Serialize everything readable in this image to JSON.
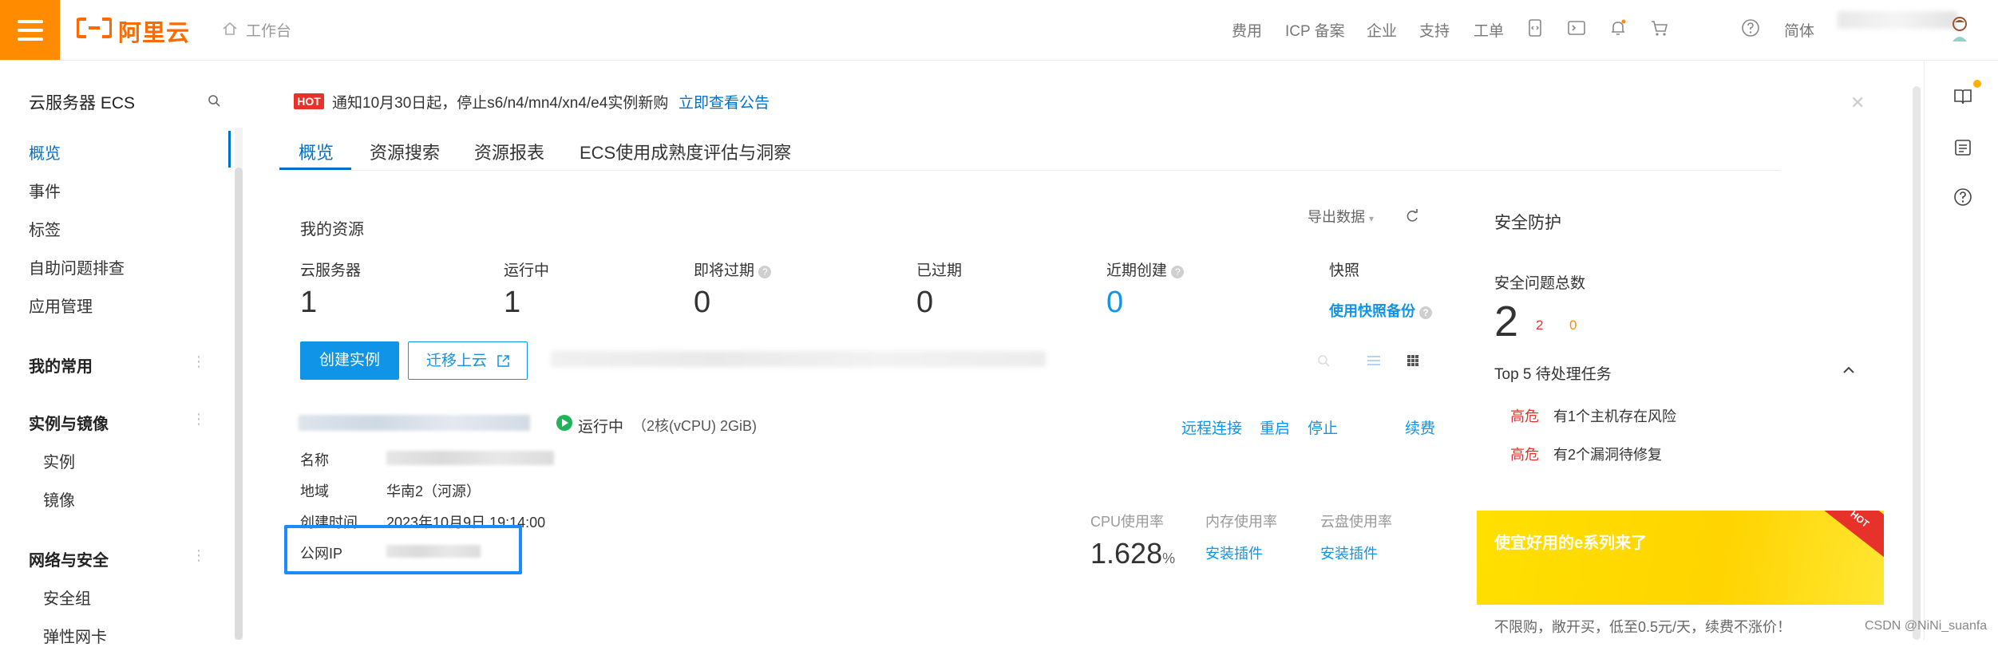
{
  "brand": {
    "name": "阿里云",
    "accent": "#ff6a00"
  },
  "breadcrumb": "工作台",
  "topnav": [
    "费用",
    "ICP 备案",
    "企业",
    "支持",
    "工单"
  ],
  "topnav_lang": "简体",
  "sidebar": {
    "title": "云服务器 ECS",
    "items": [
      "概览",
      "事件",
      "标签",
      "自助问题排查",
      "应用管理"
    ],
    "groups": [
      {
        "label": "我的常用",
        "subs": []
      },
      {
        "label": "实例与镜像",
        "subs": [
          "实例",
          "镜像"
        ]
      },
      {
        "label": "网络与安全",
        "subs": [
          "安全组",
          "弹性网卡"
        ]
      }
    ]
  },
  "notice": {
    "tag": "HOT",
    "text": "通知10月30日起，停止s6/n4/mn4/xn4/e4实例新购",
    "link": "立即查看公告"
  },
  "tabs": [
    "概览",
    "资源搜索",
    "资源报表",
    "ECS使用成熟度评估与洞察"
  ],
  "resources": {
    "title": "我的资源",
    "export": "导出数据",
    "stats": [
      {
        "label": "云服务器",
        "value": "1"
      },
      {
        "label": "运行中",
        "value": "1"
      },
      {
        "label": "即将过期",
        "value": "0"
      },
      {
        "label": "已过期",
        "value": "0"
      },
      {
        "label": "近期创建",
        "value": "0"
      },
      {
        "label": "快照",
        "value": "使用快照备份"
      }
    ],
    "create_btn": "创建实例",
    "migrate_btn": "迁移上云"
  },
  "instance": {
    "status": "运行中",
    "spec": "（2核(vCPU) 2GiB)",
    "actions": [
      "远程连接",
      "重启",
      "停止",
      "续费"
    ],
    "fields": [
      {
        "label": "名称",
        "value": ""
      },
      {
        "label": "地域",
        "value": "华南2（河源）"
      },
      {
        "label": "创建时间",
        "value": "2023年10月9日 19:14:00"
      },
      {
        "label": "公网IP",
        "value": ""
      }
    ],
    "metrics": {
      "cpu_label": "CPU使用率",
      "cpu_value": "1.628",
      "cpu_unit": "%",
      "mem_label": "内存使用率",
      "mem_action": "安装插件",
      "disk_label": "云盘使用率",
      "disk_action": "安装插件"
    }
  },
  "security": {
    "title": "安全防护",
    "total_label": "安全问题总数",
    "total": "2",
    "red": "2",
    "orange": "0",
    "top5_label": "Top 5 待处理任务",
    "tasks": [
      {
        "level": "高危",
        "text": "有1个主机存在风险"
      },
      {
        "level": "高危",
        "text": "有2个漏洞待修复"
      }
    ],
    "promo_title": "使宜好用的e系列来了",
    "promo_tag": "HOT",
    "promo_foot": "不限购，敞开买，低至0.5元/天，续费不涨价！"
  },
  "watermark": "CSDN @NiNi_suanfa"
}
